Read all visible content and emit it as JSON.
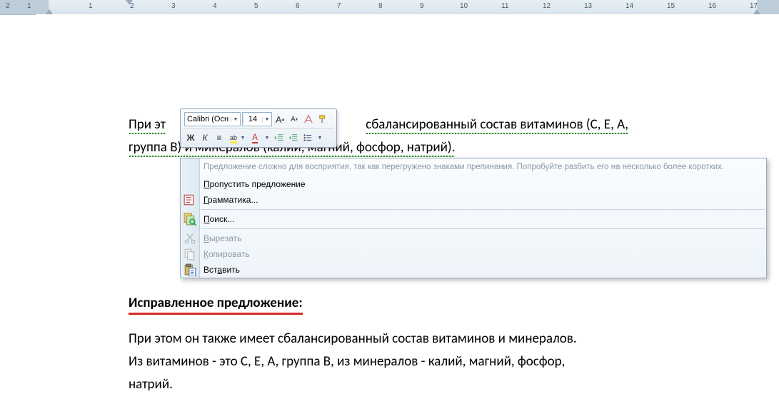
{
  "ruler": {
    "numbers": [
      "1",
      "2",
      "1",
      "2",
      "3",
      "4",
      "5",
      "6",
      "7",
      "8",
      "9",
      "10",
      "11",
      "12",
      "13",
      "14",
      "15",
      "16",
      "17"
    ],
    "left_margin_end": 180,
    "right_margin_start": 1053
  },
  "document": {
    "para1_seg1": "При эт",
    "para1_seg2": "сбалансированный состав витаминов (С, Е, А,",
    "para1_line2": "группа В) и минералов (калии, магний, фосфор, натрий).",
    "heading": "Исправленное предложение:",
    "para2_line1": "При этом он также имеет сбалансированный состав витаминов и минералов.",
    "para2_line2": "Из витаминов - это С, Е, А, группа В, из минералов - калий, магний, фосфор,",
    "para2_line3": "натрий."
  },
  "mini_toolbar": {
    "font_name": "Calibri (Осн",
    "font_size": "14",
    "btn_bold": "Ж",
    "btn_italic": "К",
    "btn_center": "≡"
  },
  "context_menu": {
    "suggestion": "Предложение сложно для восприятия, так как перегружено знаками препинания. Попробуйте разбить его на несколько более коротких.",
    "skip": "Пропустить предложение",
    "grammar": "Грамматика...",
    "lookup": "Поиск...",
    "cut": "Вырезать",
    "copy": "Копировать",
    "paste": "Вставить"
  }
}
